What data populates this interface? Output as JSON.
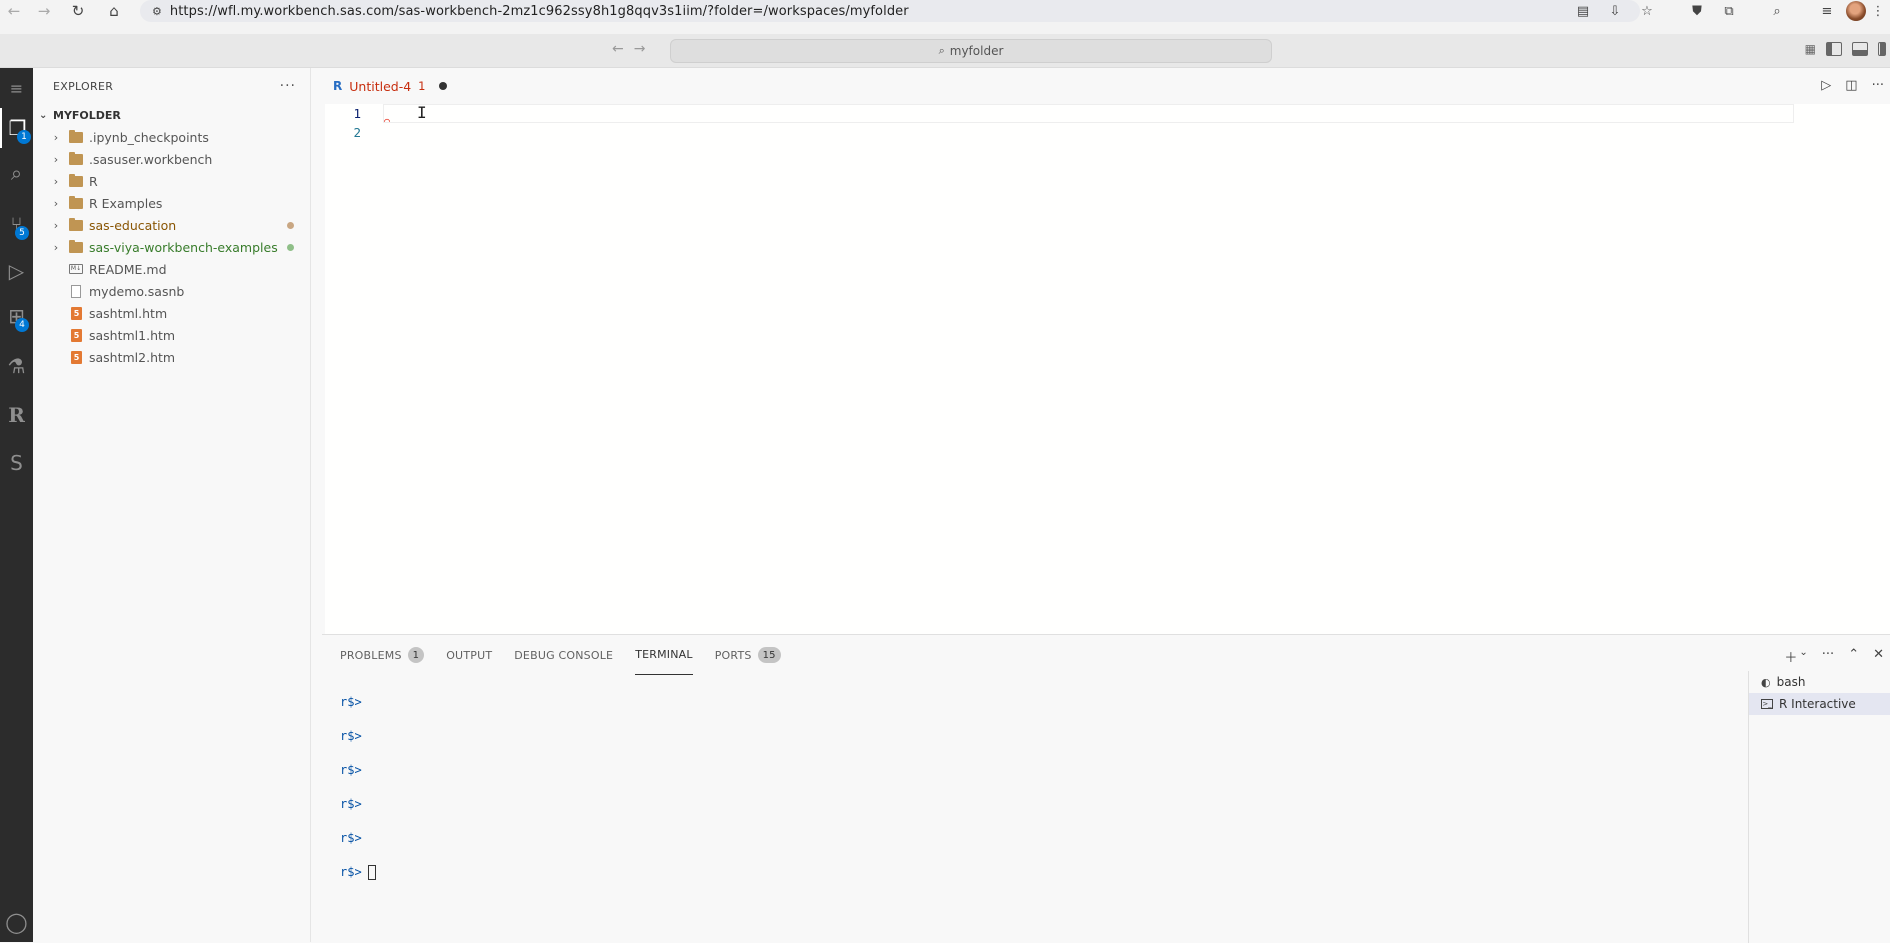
{
  "browser": {
    "url": "https://wfl.my.workbench.sas.com/sas-workbench-2mz1c962ssy8h1g8qqv3s1iim/?folder=/workspaces/myfolder"
  },
  "titlebar": {
    "search_text": "myfolder"
  },
  "activity_bar": {
    "explorer_badge": "1",
    "scm_badge": "5",
    "extensions_badge": "4"
  },
  "sidebar": {
    "title": "EXPLORER",
    "more": "···",
    "folder": "MYFOLDER",
    "items": [
      {
        "label": ".ipynb_checkpoints",
        "type": "folder"
      },
      {
        "label": ".sasuser.workbench",
        "type": "folder"
      },
      {
        "label": "R",
        "type": "folder"
      },
      {
        "label": "R Examples",
        "type": "folder"
      },
      {
        "label": "sas-education",
        "type": "folder",
        "status_color": "#c09553"
      },
      {
        "label": "sas-viya-workbench-examples",
        "type": "folder",
        "status_color": "#73a56c"
      },
      {
        "label": "README.md",
        "type": "markdown"
      },
      {
        "label": "mydemo.sasnb",
        "type": "file"
      },
      {
        "label": "sashtml.htm",
        "type": "html"
      },
      {
        "label": "sashtml1.htm",
        "type": "html"
      },
      {
        "label": "sashtml2.htm",
        "type": "html"
      }
    ]
  },
  "editor": {
    "tab_label": "Untitled-4",
    "tab_problem_count": "1",
    "tab_icon": "R",
    "line_numbers": [
      "1",
      "2"
    ]
  },
  "panel": {
    "tabs": {
      "problems": "PROBLEMS",
      "problems_count": "1",
      "output": "OUTPUT",
      "debug_console": "DEBUG CONSOLE",
      "terminal": "TERMINAL",
      "ports": "PORTS",
      "ports_count": "15"
    },
    "terminal_prompts": [
      "r$>",
      "r$>",
      "r$>",
      "r$>",
      "r$>",
      "r$>"
    ],
    "terminals": [
      "bash",
      "R Interactive"
    ]
  },
  "colors": {
    "accent": "#0078d4",
    "activity_bg": "#2c2c2c",
    "modified_folder": "#895503",
    "added_folder": "#387c2b"
  }
}
